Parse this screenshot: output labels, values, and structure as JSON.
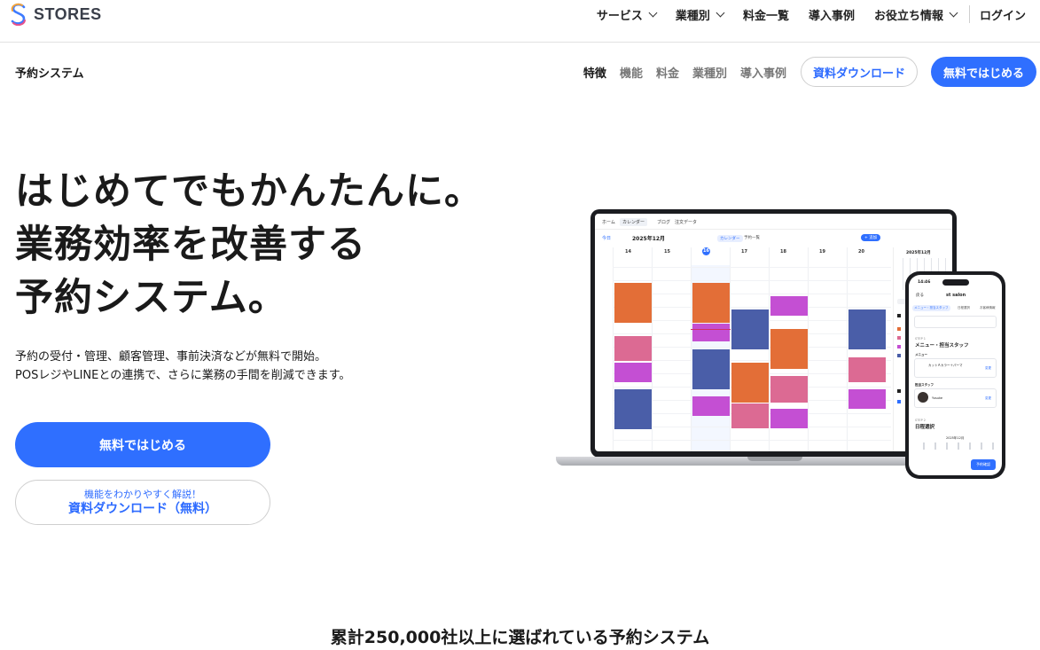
{
  "brand": {
    "name": "STORES"
  },
  "topnav": {
    "items": [
      {
        "label": "サービス",
        "dropdown": true
      },
      {
        "label": "業種別",
        "dropdown": true
      },
      {
        "label": "料金一覧",
        "dropdown": false
      },
      {
        "label": "導入事例",
        "dropdown": false
      },
      {
        "label": "お役立ち情報",
        "dropdown": true
      }
    ],
    "login": "ログイン"
  },
  "subnav": {
    "title": "予約システム",
    "links": [
      "特徴",
      "機能",
      "料金",
      "業種別",
      "導入事例"
    ],
    "doc_button": "資料ダウンロード",
    "start_button": "無料ではじめる"
  },
  "hero": {
    "title_lines": [
      "はじめてでもかんたんに。",
      "業務効率を改善する",
      "予約システム。"
    ],
    "desc_lines": [
      "予約の受付・管理、顧客管理、事前決済などが無料で開始。",
      "POSレジやLINEとの連携で、さらに業務の手間を削減できます。"
    ],
    "start_button": "無料ではじめる",
    "doc_button_sub": "機能をわかりやすく解説！",
    "doc_button_main": "資料ダウンロード（無料）"
  },
  "bottom_heading": "累計250,000社以上に選ばれている予約システム",
  "laptop_screen": {
    "tabs": [
      "ホーム",
      "カレンダー",
      "ブログ",
      "注文データ"
    ],
    "today": "今日",
    "month": "2025年12月",
    "view_tabs": [
      "カレンダー",
      "予約一覧"
    ],
    "add_button": "+ 追加",
    "days": [
      "14",
      "15",
      "16",
      "17",
      "18",
      "19",
      "20"
    ],
    "mini_month": "2025年12月"
  },
  "phone_screen": {
    "time": "14:46",
    "back": "戻る",
    "shop": "st salon",
    "tabs": [
      "メニュー・担当スタッフ",
      "日程選択",
      "お客様情報"
    ],
    "step1": "STEP 1",
    "step1_title": "メニュー・担当スタッフ",
    "menu_label": "メニュー",
    "menu_item": "カットＡカラー＋パーマ",
    "staff_label": "担当スタッフ",
    "staff_name": "Yusuke",
    "change": "変更",
    "step2": "STEP 2",
    "step2_title": "日程選択",
    "month": "2025年12月",
    "reserve_button": "予約確認"
  },
  "colors": {
    "primary": "#2f6fff",
    "event_orange": "#e36e37",
    "event_blue": "#4a5ea8",
    "event_pink": "#dc6a93",
    "event_purple": "#c44fd3"
  }
}
